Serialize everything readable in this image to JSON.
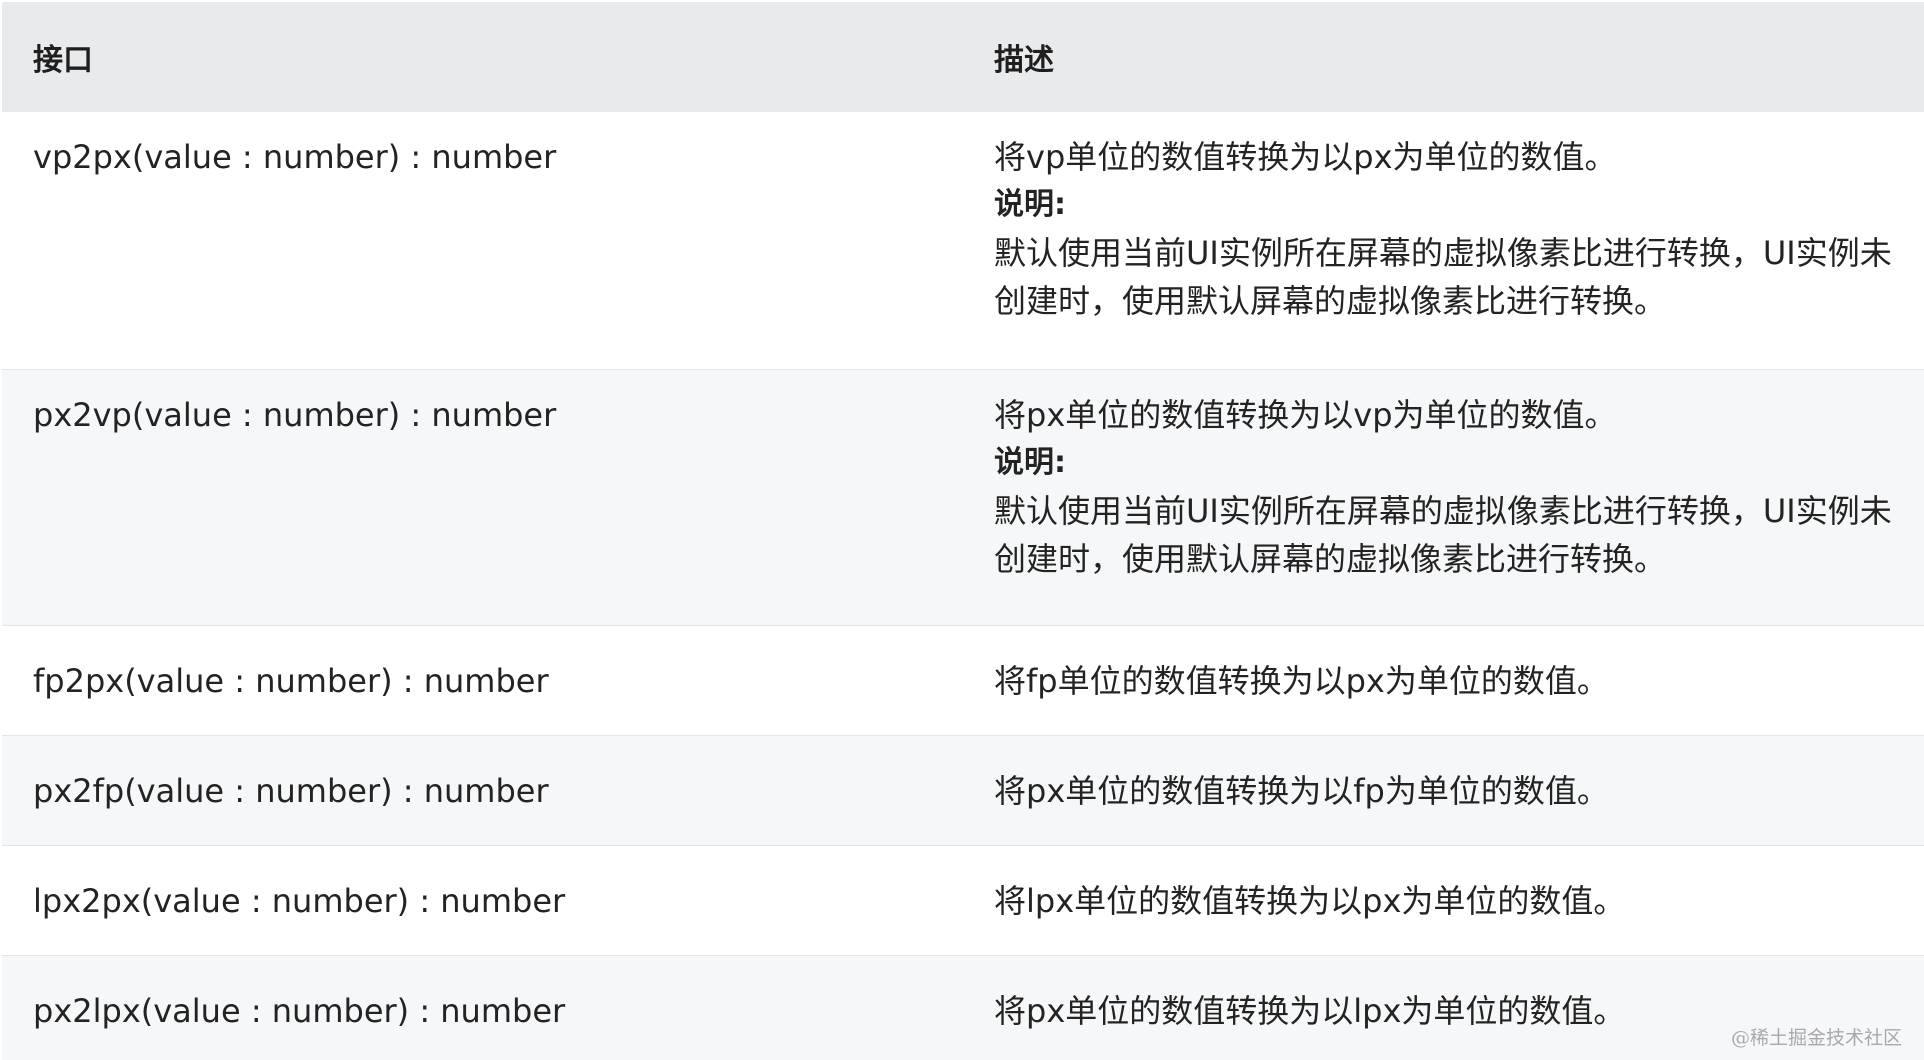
{
  "table": {
    "headers": {
      "interface": "接口",
      "description": "描述"
    },
    "rows": [
      {
        "interface": "vp2px(value : number) : number",
        "description": "将vp单位的数值转换为以px为单位的数值。",
        "note_label": "说明:",
        "note_text": "默认使用当前UI实例所在屏幕的虚拟像素比进行转换，UI实例未创建时，使用默认屏幕的虚拟像素比进行转换。"
      },
      {
        "interface": "px2vp(value : number) : number",
        "description": "将px单位的数值转换为以vp为单位的数值。",
        "note_label": "说明:",
        "note_text": "默认使用当前UI实例所在屏幕的虚拟像素比进行转换，UI实例未创建时，使用默认屏幕的虚拟像素比进行转换。"
      },
      {
        "interface": "fp2px(value : number) : number",
        "description": "将fp单位的数值转换为以px为单位的数值。"
      },
      {
        "interface": "px2fp(value : number) : number",
        "description": "将px单位的数值转换为以fp为单位的数值。"
      },
      {
        "interface": "lpx2px(value : number) : number",
        "description": "将lpx单位的数值转换为以px为单位的数值。"
      },
      {
        "interface": "px2lpx(value : number) : number",
        "description": "将px单位的数值转换为以lpx为单位的数值。"
      }
    ]
  },
  "watermark": "@稀土掘金技术社区"
}
